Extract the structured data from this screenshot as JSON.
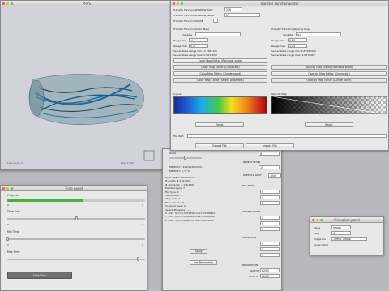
{
  "para": {
    "title": "PRVS",
    "slab_left": "Live mode: 0",
    "slab_right": "Res: 1.156"
  },
  "tf": {
    "title": "Transfer Function Editor",
    "top_rows": [
      {
        "label": "Transfer Function WINDOW_SIZE",
        "value": "256"
      },
      {
        "label": "Transfer Function WINDOW_NAME",
        "value": "tf1"
      },
      {
        "label": "Transfer Function SHAPE",
        "value": ""
      }
    ],
    "color": {
      "header": "Transfer Function (Color Map)",
      "variable_label": "Variable",
      "variable_value": "",
      "range_min_label": "Range min",
      "range_min_value": "-0.1",
      "range_max_label": "Range max",
      "range_max_value": "0.1",
      "info1": "Server state range min: -0.1661125",
      "info2": "Server state range max: 0.0633634",
      "buttons": [
        "Color Map Editor (Rainbow scale)",
        "Color Map Editor (Grayscale)",
        "Color Map Editor (Divide point)",
        "Color Map Editor (Select plot/reset)"
      ],
      "section_label": "Colour",
      "reset": "Reset"
    },
    "opacity": {
      "header": "Transfer Function (Opacity Map)",
      "variable_label": "Variable",
      "variable_value": "q1",
      "range_min_label": "Range min",
      "range_min_value": "0.85",
      "range_max_label": "Range max",
      "range_max_value": "1.05",
      "info1": "Server state range min: 0.87585394",
      "info2": "Server state range max: 1.0378467",
      "buttons": [
        "Opacity Map Editor (Rainbow scale)",
        "Opacity Map Editor (Grayscale)",
        "Opacity Map Editor (Divide point)"
      ],
      "section_label": "Opacity Map",
      "reset": "Reset"
    },
    "file_path_label": "File Path",
    "export": "Export File",
    "import": "Import File"
  },
  "panel": {
    "fields": [
      {
        "label": "Scale",
        "value": "8"
      },
      {
        "label": "REPEAT LEVEL",
        "value": "15"
      },
      {
        "label": "PARTICLE LIMIT",
        "value": "100k"
      }
    ],
    "mem1": "MEMORY: 1120/1120 100%",
    "mem2": "MEMORY: 0 / 0 %",
    "info_lines": [
      "Point / Filter Information",
      "# points: 2,116,800",
      "# elements: 2,116,800",
      "Element type: 7",
      "File type: 0",
      "Vector num: 3",
      "Step num: 1",
      "Pass values: 16",
      "Subpixel level: 2",
      "Select 3D space ------",
      "X - min: min=-0.0701344, max=0.0183653",
      "Y - min: min=-0.0100502, max=0.0158200",
      "Z - min: min=0.0988233, max=0.0219582"
    ],
    "apply": "Apply",
    "set_parameter": "Set Parameter",
    "eye_point": {
      "title": "EYE POINT",
      "values": [
        "0",
        "0",
        "6"
      ]
    },
    "center_point": {
      "title": "CENTER POINT",
      "values": [
        "0",
        "0",
        "0"
      ]
    },
    "up_vector": {
      "title": "UP VECTOR",
      "values": [
        "0",
        "1",
        "0"
      ]
    },
    "resolution": {
      "title": "RESOLUTION",
      "width_label": "WIDTH",
      "width": "620.0",
      "height_label": "HEIGHT",
      "height": "620.0"
    }
  },
  "time": {
    "title": "Time panel",
    "progress_label": "Progress",
    "progress": 0.55,
    "sliders": [
      {
        "label": "Time step",
        "min": "0",
        "max": "4",
        "value": 0.5
      },
      {
        "label": "Min Time",
        "min": "0",
        "max": "4",
        "value": 0.0
      },
      {
        "label": "Max Time",
        "min": "0",
        "max": "4",
        "value": 0.95
      }
    ],
    "start_stop": "Start/Stop"
  },
  "anim": {
    "title": "Animation panel",
    "mode_label": "Mode",
    "mode_value": "Image",
    "loop_label": "Loop",
    "loop_value": "4",
    "image_file_label": "Image file",
    "image_file_value": "./PRVS_image",
    "serial_label": "Serial name"
  },
  "colors": {
    "rainbow": [
      "#2040c8",
      "#10a0e0",
      "#40c040",
      "#f0e020",
      "#f08010",
      "#d02010"
    ]
  }
}
